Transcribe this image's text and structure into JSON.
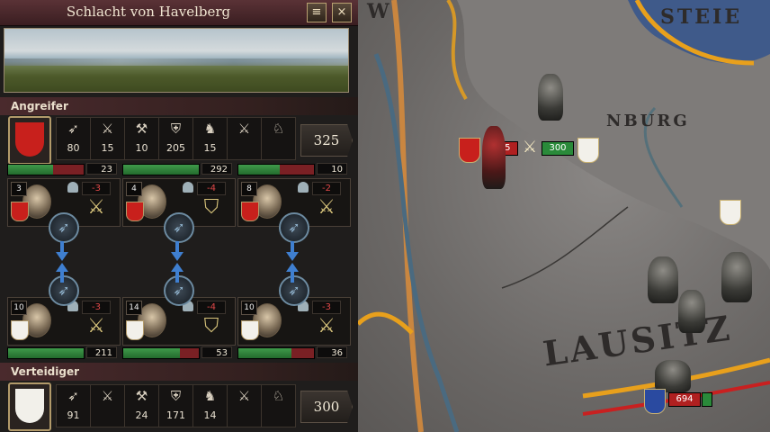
{
  "battle": {
    "title": "Schlacht von Havelberg",
    "close_icon": "×",
    "log_icon": "≡"
  },
  "colors": {
    "attacker": "#c8201c",
    "defender": "#f2f0ea",
    "hp_green": "#2f8a3c",
    "hp_red": "#7a2024"
  },
  "attacker": {
    "label": "Angreifer",
    "units": [
      {
        "icon": "light-infantry-icon",
        "value": "80"
      },
      {
        "icon": "heavy-infantry-icon",
        "value": "15"
      },
      {
        "icon": "pikemen-icon",
        "value": "10"
      },
      {
        "icon": "archers-icon",
        "value": "205"
      },
      {
        "icon": "light-cavalry-icon",
        "value": "15"
      },
      {
        "icon": "knights-icon",
        "value": ""
      },
      {
        "icon": "horse-archers-icon",
        "value": ""
      }
    ],
    "total": "325",
    "flanks": [
      {
        "count": "23",
        "level": "3",
        "modifier": "-3",
        "hp": 0.6
      },
      {
        "count": "292",
        "level": "4",
        "modifier": "-4",
        "hp": 1.0
      },
      {
        "count": "10",
        "level": "8",
        "modifier": "-2",
        "hp": 0.55
      }
    ]
  },
  "defender": {
    "label": "Verteidiger",
    "units": [
      {
        "icon": "light-infantry-icon",
        "value": "91"
      },
      {
        "icon": "heavy-infantry-icon",
        "value": ""
      },
      {
        "icon": "pikemen-icon",
        "value": "24"
      },
      {
        "icon": "archers-icon",
        "value": "171"
      },
      {
        "icon": "light-cavalry-icon",
        "value": "14"
      },
      {
        "icon": "knights-icon",
        "value": ""
      },
      {
        "icon": "horse-archers-icon",
        "value": ""
      }
    ],
    "total": "300",
    "flanks": [
      {
        "count": "211",
        "level": "10",
        "modifier": "-3",
        "hp": 1.0
      },
      {
        "count": "53",
        "level": "14",
        "modifier": "-4",
        "hp": 0.75
      },
      {
        "count": "36",
        "level": "10",
        "modifier": "-3",
        "hp": 0.7
      }
    ]
  },
  "map": {
    "labels": {
      "lausitz": "LAUSITZ",
      "burg": "NBURG",
      "steie": "STEIE",
      "w": "W"
    },
    "battle_attacker_strength": "325",
    "battle_defender_strength": "300",
    "army_strength": "694"
  }
}
